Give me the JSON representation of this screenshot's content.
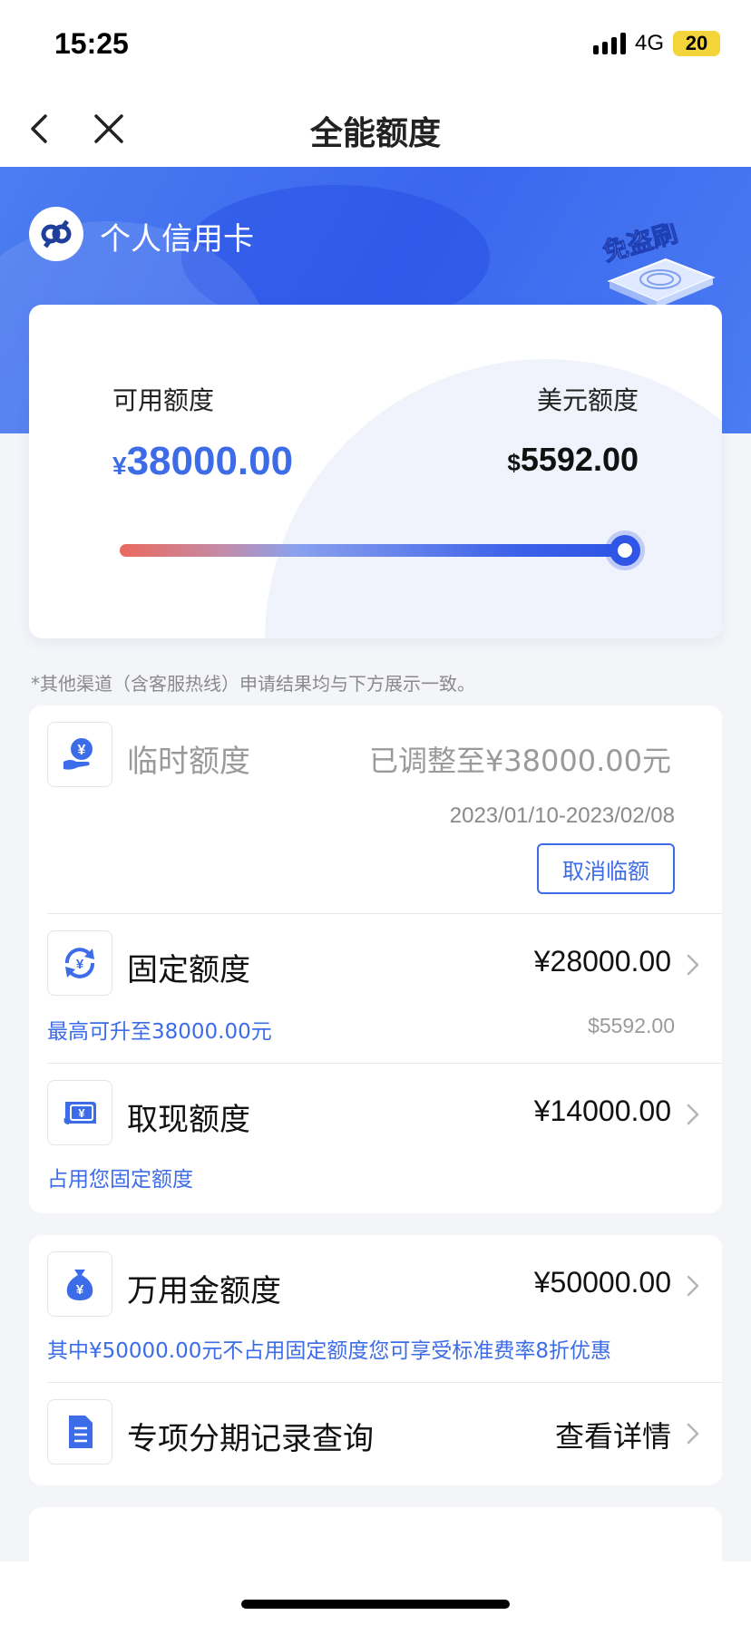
{
  "status_bar": {
    "time": "15:25",
    "network": "4G",
    "battery": "20"
  },
  "nav": {
    "title": "全能额度"
  },
  "hero": {
    "card_name": "个人信用卡",
    "badge_text": "免盗刷"
  },
  "limits": {
    "available_label": "可用额度",
    "available_currency": "¥",
    "available_value": "38000.00",
    "usd_label": "美元额度",
    "usd_currency": "$",
    "usd_value": "5592.00",
    "slider_fraction": 1.0
  },
  "notice": "*其他渠道（含客服热线）申请结果均与下方展示一致。",
  "colors": {
    "accent": "#3d6ce8",
    "hero": "#3a67ee",
    "slider_start": "#e96a5e"
  },
  "temp_limit": {
    "icon": "hand-yen-icon",
    "title": "临时额度",
    "status": "已调整至¥38000.00元",
    "date_range": "2023/01/10-2023/02/08",
    "cancel_label": "取消临额"
  },
  "fixed_limit": {
    "icon": "yen-cycle-icon",
    "title": "固定额度",
    "amount": "¥28000.00",
    "sub_left": "最高可升至38000.00元",
    "sub_right": "$5592.00"
  },
  "cash_limit": {
    "icon": "banknote-icon",
    "title": "取现额度",
    "amount": "¥14000.00",
    "sub_left": "占用您固定额度"
  },
  "wanyongjin": {
    "icon": "money-bag-icon",
    "title": "万用金额度",
    "amount": "¥50000.00",
    "sub_left": "其中¥50000.00元不占用固定额度您可享受标准费率8折优惠"
  },
  "installment": {
    "icon": "document-icon",
    "title": "专项分期记录查询",
    "action": "查看详情"
  }
}
